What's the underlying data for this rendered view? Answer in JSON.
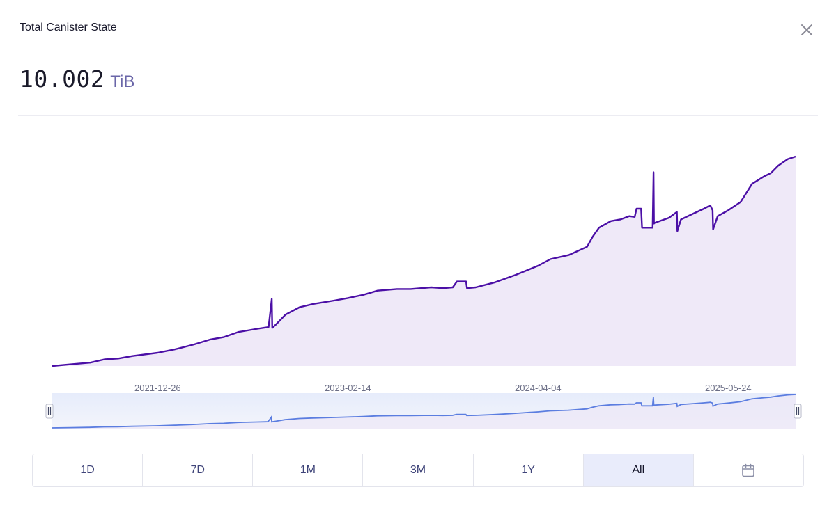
{
  "header": {
    "title": "Total Canister State",
    "value": "10.002",
    "unit": "TiB"
  },
  "range_buttons": [
    "1D",
    "7D",
    "1M",
    "3M",
    "1Y",
    "All"
  ],
  "active_range": "All",
  "icons": {
    "close": "close-icon",
    "calendar": "calendar-icon"
  },
  "colors": {
    "line": "#4b0fa6",
    "area": "#efe9f8",
    "nav_line": "#5b7de0",
    "active_button_bg": "#e9ecfb"
  },
  "chart_data": {
    "type": "area",
    "title": "",
    "xlabel": "",
    "ylabel": "",
    "unit": "TiB",
    "x_ticks": [
      "2021-12-26",
      "2023-02-14",
      "2024-04-04",
      "2025-05-24"
    ],
    "y_axis_shown": false,
    "grid": false,
    "series": [
      {
        "x": [
          "2021-05-10",
          "2021-06-20",
          "2021-08-01",
          "2021-09-01",
          "2021-10-01",
          "2021-11-01",
          "2021-12-26",
          "2022-02-01",
          "2022-03-15",
          "2022-04-20",
          "2022-05-20",
          "2022-06-20",
          "2022-07-01",
          "2022-08-01",
          "2022-08-25",
          "2022-09-01",
          "2022-09-02",
          "2022-09-10",
          "2022-10-01",
          "2022-11-01",
          "2022-12-01",
          "2023-01-15",
          "2023-02-14",
          "2023-03-20",
          "2023-04-20",
          "2023-06-01",
          "2023-07-01",
          "2023-08-15",
          "2023-09-10",
          "2023-10-01",
          "2023-10-10",
          "2023-10-30",
          "2023-11-01",
          "2023-11-20",
          "2024-01-01",
          "2024-02-15",
          "2024-04-04",
          "2024-05-01",
          "2024-06-10",
          "2024-07-20",
          "2024-08-01",
          "2024-08-15",
          "2024-09-10",
          "2024-10-01",
          "2024-10-20",
          "2024-11-01",
          "2024-11-05",
          "2024-11-15",
          "2024-11-17",
          "2024-12-01",
          "2024-12-10",
          "2024-12-12",
          "2024-12-13",
          "2024-12-15",
          "2025-01-15",
          "2025-02-01",
          "2025-02-02",
          "2025-02-10",
          "2025-03-01",
          "2025-04-01",
          "2025-04-15",
          "2025-04-20",
          "2025-04-21",
          "2025-05-01",
          "2025-05-24",
          "2025-06-20",
          "2025-07-15",
          "2025-08-10",
          "2025-08-25",
          "2025-09-10",
          "2025-10-01",
          "2025-10-18"
        ],
        "y": [
          0.0,
          0.1,
          0.2,
          0.4,
          0.45,
          0.6,
          0.8,
          1.0,
          1.3,
          1.6,
          1.75,
          2.05,
          2.1,
          2.25,
          2.35,
          4.05,
          2.3,
          2.5,
          3.1,
          3.55,
          3.75,
          3.95,
          4.1,
          4.3,
          4.55,
          4.65,
          4.65,
          4.75,
          4.7,
          4.75,
          5.1,
          5.1,
          4.7,
          4.75,
          5.05,
          5.5,
          6.05,
          6.45,
          6.7,
          7.2,
          7.8,
          8.35,
          8.75,
          8.85,
          9.05,
          9.0,
          9.5,
          9.5,
          8.35,
          8.35,
          8.35,
          11.7,
          8.6,
          8.65,
          8.95,
          9.3,
          8.15,
          8.85,
          9.1,
          9.5,
          9.7,
          9.4,
          8.25,
          9.05,
          9.4,
          9.9,
          11.0,
          11.45,
          11.65,
          12.1,
          12.5,
          12.65
        ]
      }
    ]
  }
}
